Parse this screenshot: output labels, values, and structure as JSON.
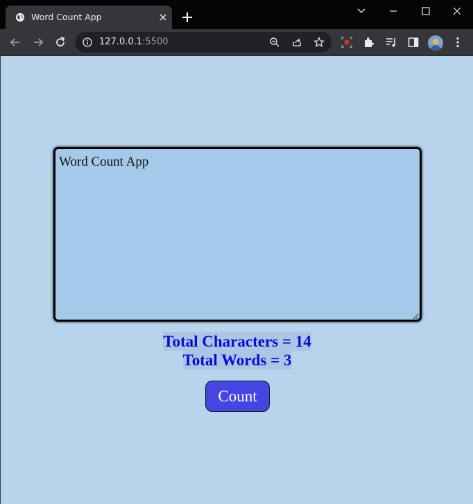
{
  "browser": {
    "tab_title": "Word Count App",
    "url_host": "127.0.0.1",
    "url_port": ":5500"
  },
  "app": {
    "textarea_value": "Word Count App",
    "total_characters_label": "Total Characters = 14",
    "total_words_label": "Total Words = 3",
    "count_button_label": "Count"
  },
  "colors": {
    "page_background": "#b8d4ec",
    "textarea_background": "#a5c9e8",
    "stats_text": "#0a0ad8",
    "button_background": "#4545e2"
  }
}
